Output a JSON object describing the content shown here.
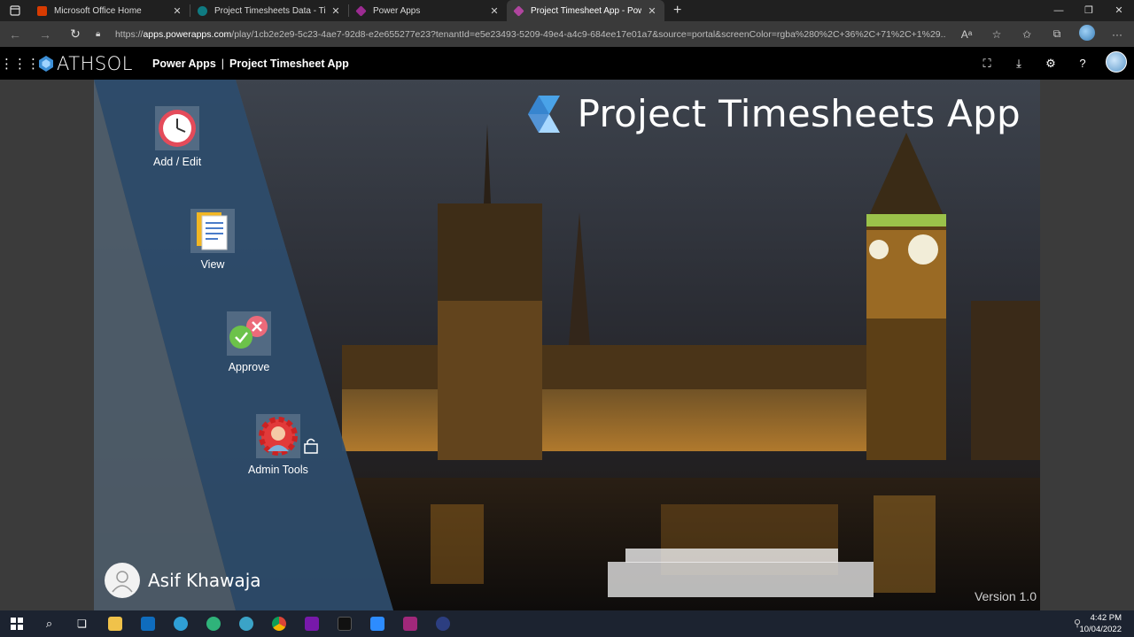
{
  "browser": {
    "tabs": [
      {
        "title": "Microsoft Office Home",
        "icon": "office-icon",
        "color": "#d83b01",
        "active": false
      },
      {
        "title": "Project Timesheets Data - Timesh",
        "icon": "sharepoint-icon",
        "color": "#0f7b82",
        "active": false
      },
      {
        "title": "Power Apps",
        "icon": "powerapps-icon",
        "color": "#9c2b91",
        "active": false
      },
      {
        "title": "Project Timesheet App - Power A",
        "icon": "powerapps-icon",
        "color": "#b0459f",
        "active": true
      }
    ],
    "new_tab": "+",
    "url_prefix": "https://",
    "url_host": "apps.powerapps.com",
    "url_rest": "/play/1cb2e2e9-5c23-4ae7-92d8-e2e655277e23?tenantId=e5e23493-5209-49e4-a4c9-684ee17e01a7&source=portal&screenColor=rgba%280%2C+36%2C+71%2C+1%29..."
  },
  "header": {
    "logo_text": "ATHSOL",
    "app_service": "Power Apps",
    "separator": "|",
    "app_name": "Project Timesheet App"
  },
  "app": {
    "title": "Project Timesheets App",
    "menu": [
      {
        "label": "Add / Edit",
        "icon": "clock-icon"
      },
      {
        "label": "View",
        "icon": "document-icon"
      },
      {
        "label": "Approve",
        "icon": "approve-reject-icon"
      },
      {
        "label": "Admin Tools",
        "icon": "admin-gear-icon"
      }
    ],
    "user_name": "Asif Khawaja",
    "version": "Version 1.0"
  },
  "taskbar": {
    "time": "4:42 PM",
    "date": "10/04/2022"
  },
  "colors": {
    "panel": "#294766",
    "accent_blue": "#4aa3e8"
  }
}
